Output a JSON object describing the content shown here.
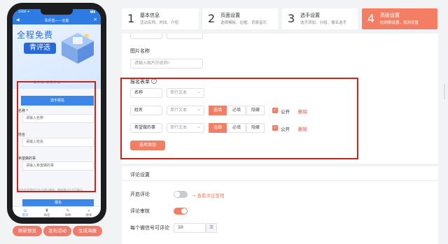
{
  "phone": {
    "status_time": "1000 ✦",
    "status_battery": "▮▮▮",
    "nav_title": "青评选——全能",
    "banner_line1": "全程免费",
    "banner_line2": "青评选",
    "banner_brand": "青 评 选 · 投 票 评 选",
    "signup_tab": "选手报名",
    "fields": [
      {
        "label": "名称 *",
        "placeholder": "请输入名称"
      },
      {
        "label": "姓名",
        "placeholder": "请输入姓名"
      },
      {
        "label": "希望做的事",
        "placeholder": "请输入希望做的事"
      }
    ],
    "note": "报名信息将由主办方进行审核，审核通过后方可展示",
    "submit": "报名",
    "tabbar": [
      {
        "icon": "⌂",
        "label": "首页"
      },
      {
        "icon": "♜",
        "label": "排名"
      },
      {
        "icon": "✎",
        "label": "详情"
      },
      {
        "icon": "⌕",
        "label": "搜索"
      }
    ]
  },
  "phone_buttons": [
    "刷新预览",
    "发布活动",
    "生成海报"
  ],
  "steps": [
    {
      "num": "1",
      "title": "基本信息",
      "desc": "活动名称、时间、介绍"
    },
    {
      "num": "2",
      "title": "页面设置",
      "desc": "选择模板、边框、背景音乐"
    },
    {
      "num": "3",
      "title": "选手设置",
      "desc": "选手添加、分组、报名选手"
    },
    {
      "num": "4",
      "title": "高级设置",
      "desc": "防刷票设置、规则设置"
    }
  ],
  "image_name": {
    "label": "图片名称",
    "placeholder": "请输入图片的名称!"
  },
  "signup_form": {
    "label": "报名表单",
    "help": "?",
    "rows": [
      {
        "name": "名称",
        "type": "单行文本",
        "toggles": null
      },
      {
        "name": "姓名",
        "type": "单行文本",
        "toggles": [
          "选填",
          "必填",
          "隐藏"
        ],
        "public": "公开",
        "delete": "删除"
      },
      {
        "name": "希望做的事",
        "type": "单行文本",
        "toggles": [
          "选填",
          "必填",
          "隐藏"
        ],
        "public": "公开",
        "delete": "删除"
      }
    ],
    "add_button": "选项添加"
  },
  "comments": {
    "section_title": "评论设置",
    "enable_label": "开启评论",
    "manage_link": "→ 查看评论管理",
    "review_label": "评论审核",
    "per_user_label": "每个微信号可评论",
    "per_user_value": "10",
    "per_user_unit": "次"
  },
  "colors": {
    "accent": "#f47e63",
    "phone_blue": "#2d7be3",
    "highlight_red": "#c8241c"
  }
}
